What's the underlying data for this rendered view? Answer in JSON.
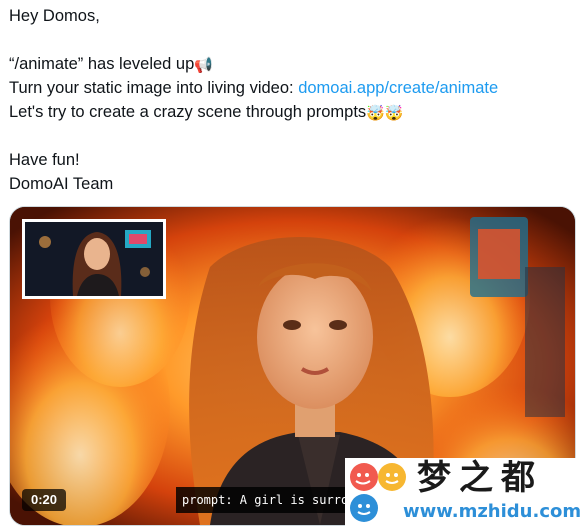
{
  "tweet": {
    "line1": "Hey Domos,",
    "line3": "“/animate” has leveled up",
    "line3_emoji": "📢",
    "line4_prefix": "Turn your static image into living video: ",
    "line4_link": "domoai.app/create/animate",
    "line5": "Let's try to create a crazy scene through prompts",
    "line5_emoji": "🤯🤯",
    "line7": "Have fun!",
    "line8": "DomoAI Team"
  },
  "video": {
    "duration": "0:20",
    "caption": "prompt: A girl is surrounded"
  },
  "watermark": {
    "site_name": "梦之都",
    "url": "www.mzhidu.com"
  },
  "colors": {
    "link": "#1d9bf0",
    "text": "#0f1419",
    "fire": "#ff8a1e",
    "watermark_url": "#2d8fd8"
  }
}
